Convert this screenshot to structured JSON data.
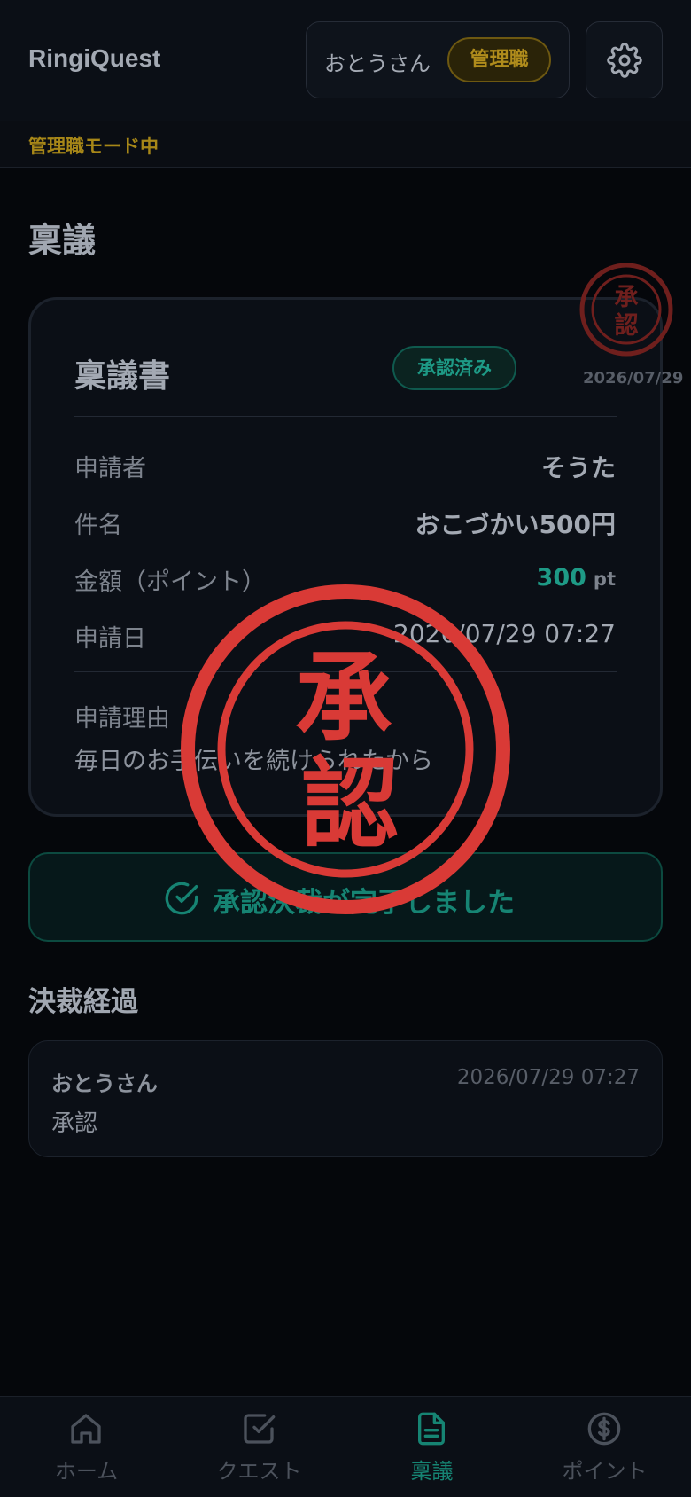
{
  "header": {
    "app_title": "RingiQuest",
    "user_name": "おとうさん",
    "role_badge": "管理職"
  },
  "mode_bar": {
    "text": "管理職モード中"
  },
  "page_title": "稟議",
  "card": {
    "title": "稟議書",
    "status": "承認済み",
    "rows": [
      {
        "label": "申請者",
        "value": "そうた"
      },
      {
        "label": "件名",
        "value": "おこづかい500円"
      },
      {
        "label": "金額（ポイント）",
        "value": "300",
        "unit": "pt"
      },
      {
        "label": "申請日",
        "value": "2026/07/29 07:27"
      }
    ],
    "reason_label": "申請理由",
    "reason_text": "毎日のお手伝いを続けられたから"
  },
  "mini_stamp": {
    "chars": [
      "承",
      "認"
    ],
    "date": "2026/07/29"
  },
  "big_stamp": {
    "chars": [
      "承",
      "認"
    ]
  },
  "done_banner": {
    "text": "承認決裁が完了しました"
  },
  "section_title": "決裁経過",
  "log": [
    {
      "actor": "おとうさん",
      "time": "2026/07/29 07:27",
      "action": "承認"
    }
  ],
  "bottom_nav": [
    {
      "label": "ホーム",
      "icon": "home-icon"
    },
    {
      "label": "クエスト",
      "icon": "check-square-icon"
    },
    {
      "label": "稟議",
      "icon": "document-icon",
      "active": true
    },
    {
      "label": "ポイント",
      "icon": "coin-icon"
    }
  ],
  "colors": {
    "background": "#05070b",
    "accent_teal": "#1e9a86",
    "accent_gold": "#b08c1c",
    "stamp_red": "#d93a36"
  }
}
